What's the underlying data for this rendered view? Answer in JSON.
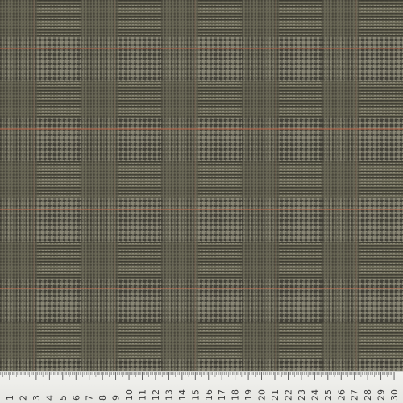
{
  "image": {
    "subject": "glen check wool fabric",
    "colors": {
      "base": "#6d6b5d",
      "dark_thread": "#3f3d33",
      "light_thread": "#9b9886",
      "overcheck": "#b8664a",
      "ruler_bg": "#efefec",
      "ruler_ink": "#3a3a3a"
    }
  },
  "ruler": {
    "labels": [
      "1",
      "2",
      "3",
      "4",
      "5",
      "6",
      "7",
      "8",
      "9",
      "10",
      "11",
      "12",
      "13",
      "14",
      "15",
      "16",
      "17",
      "18",
      "19",
      "20",
      "21",
      "22",
      "23",
      "24",
      "25",
      "26",
      "27",
      "28",
      "29",
      "30"
    ]
  }
}
